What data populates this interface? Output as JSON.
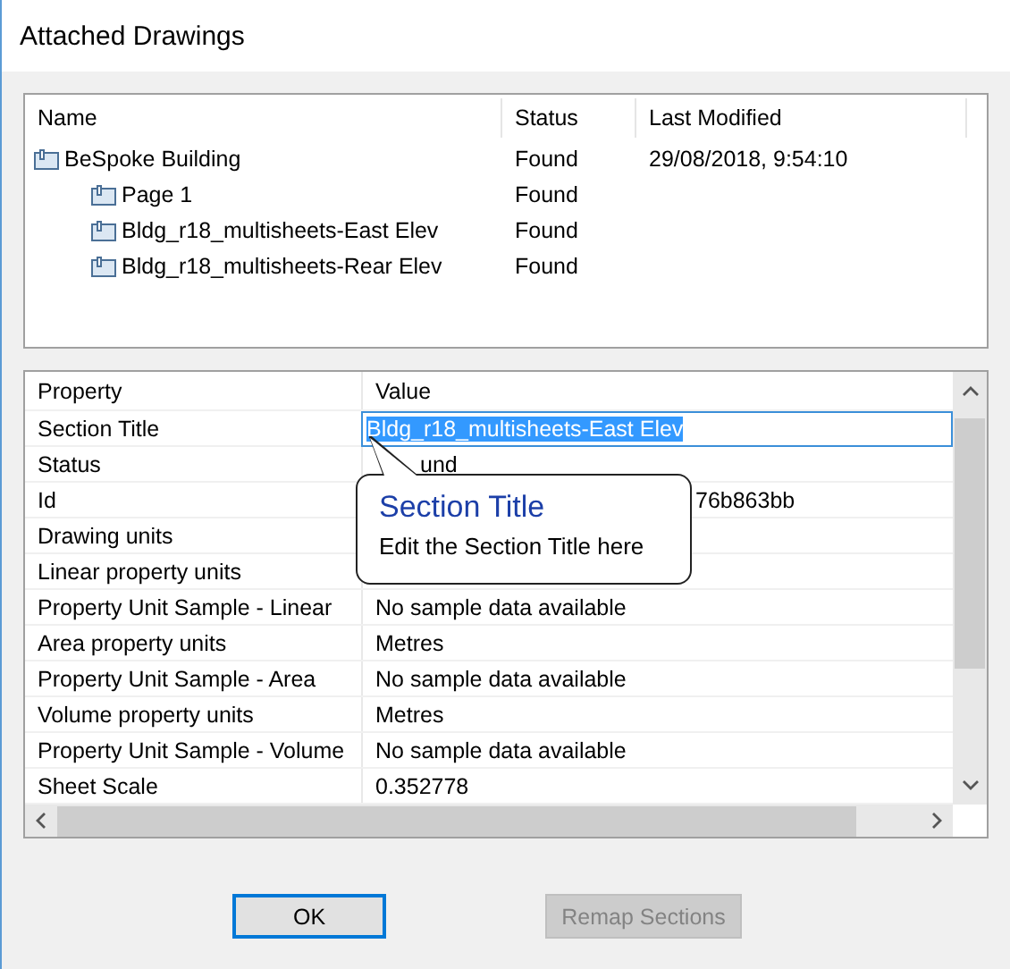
{
  "window": {
    "title": "Attached Drawings"
  },
  "tree": {
    "columns": [
      "Name",
      "Status",
      "Last Modified"
    ],
    "items": [
      {
        "name": "BeSpoke Building",
        "status": "Found",
        "modified": "29/08/2018, 9:54:10",
        "children": [
          {
            "name": "Page 1",
            "status": "Found"
          },
          {
            "name": "Bldg_r18_multisheets-East Elev",
            "status": "Found"
          },
          {
            "name": "Bldg_r18_multisheets-Rear Elev",
            "status": "Found"
          }
        ]
      }
    ]
  },
  "properties": {
    "columns": [
      "Property",
      "Value"
    ],
    "rows": [
      {
        "name": "Section Title",
        "value": "Bldg_r18_multisheets-East Elev",
        "editing": true
      },
      {
        "name": "Status",
        "value": "und",
        "kind": "behind_pointer"
      },
      {
        "name": "Id",
        "value": "76b863bb",
        "kind": "partly_hidden"
      },
      {
        "name": "Drawing units"
      },
      {
        "name": "Linear property units"
      },
      {
        "name": "Property Unit Sample - Linear",
        "value": "No sample data available"
      },
      {
        "name": "Area property units",
        "value": "Metres"
      },
      {
        "name": "Property Unit Sample - Area",
        "value": "No sample data available"
      },
      {
        "name": "Volume property units",
        "value": "Metres"
      },
      {
        "name": "Property Unit Sample - Volume",
        "value": "No sample data available"
      },
      {
        "name": "Sheet Scale",
        "value": "0.352778"
      }
    ]
  },
  "tooltip": {
    "title": "Section Title",
    "text": "Edit the Section Title here"
  },
  "buttons": [
    {
      "label": "OK",
      "disabled": false
    },
    {
      "label": "Remap Sections",
      "disabled": true
    }
  ]
}
